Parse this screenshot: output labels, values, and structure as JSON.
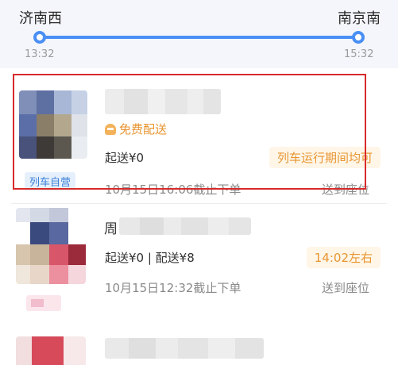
{
  "route": {
    "from_station": "济南西",
    "to_station": "南京南",
    "depart_time": "13:32",
    "arrive_time": "15:32",
    "accent_color": "#4a8ff5"
  },
  "cards": [
    {
      "free_delivery_label": "免费配送",
      "min_order_text": "起送¥0",
      "eta_text": "列车运行期间均可",
      "cutoff_text": "10月15日16:06截止下单",
      "deliver_text": "送到座位",
      "tag_text": "列车自营",
      "delivery_icon": "delivery-person-icon"
    },
    {
      "name_visible_char": "周",
      "min_order_text": "起送¥0 | 配送¥8",
      "eta_text": "14:02左右",
      "cutoff_text": "10月15日12:32截止下单",
      "deliver_text": "送到座位"
    }
  ],
  "highlight_color": "#d82a2a",
  "eta_color": "#e89531"
}
